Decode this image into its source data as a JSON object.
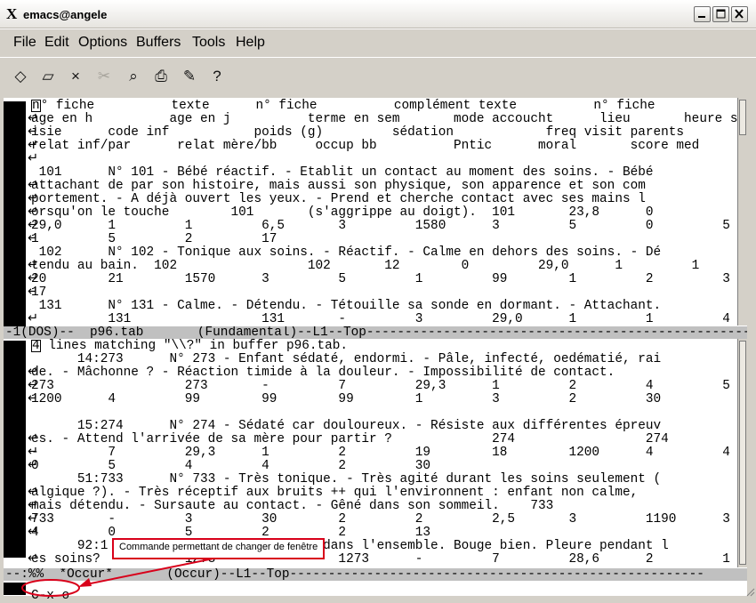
{
  "window": {
    "logo": "X",
    "title": "emacs@angele",
    "buttons": [
      "minimize",
      "maximize",
      "close"
    ]
  },
  "menu": [
    "File",
    "Edit",
    "Options",
    "Buffers",
    "Tools",
    "Help"
  ],
  "toolbar": {
    "icons": [
      "new-file-icon",
      "open-folder-icon",
      "close-x-icon",
      "cut-icon",
      "find-icon",
      "print-icon",
      "preferences-icon",
      "help-icon"
    ],
    "glyphs": [
      "◇",
      "▱",
      "×",
      "✂",
      "⌕",
      "⎙",
      "✎",
      "?"
    ]
  },
  "upper_pane": {
    "lines": [
      {
        "t": "n° fiche          texte      n° fiche          complément texte          n° fiche",
        "cursor_first": true
      },
      {
        "t": "age en h          age en j          terme en sem       mode accoucht      lieu       heure sa",
        "fringe": "↵"
      },
      {
        "t": "isie      code inf           poids (g)         sédation            freq visit parents",
        "fringe": "↵"
      },
      {
        "t": "relat inf/par      relat mère/bb     occup bb          Pntic      moral       score med",
        "fringe": "↵"
      },
      {
        "t": "",
        "fringe": "↵"
      },
      {
        "t": " 101      N° 101 - Bébé réactif. - Etablit un contact au moment des soins. - Bébé"
      },
      {
        "t": "attachant de par son histoire, mais aussi son physique, son apparence et son com",
        "fringe": "↵"
      },
      {
        "t": "portement. - A déjà ouvert les yeux. - Prend et cherche contact avec ses mains l",
        "fringe": "↵"
      },
      {
        "t": "orsqu'on le touche        101       (s'aggrippe au doigt).  101       23,8      0",
        "fringe": "↵"
      },
      {
        "t": "29,0      1         1         6,5       3         1580      3         5         0         5",
        "fringe": "↵"
      },
      {
        "t": "1         5         2         17",
        "fringe": "↵"
      },
      {
        "t": " 102      N° 102 - Tonique aux soins. - Réactif. - Calme en dehors des soins. - Dé"
      },
      {
        "t": "tendu au bain.  102                 102       12        0         29,0      1         1",
        "fringe": "↵"
      },
      {
        "t": "20        21        1570      3         5         1         99        1         2         3",
        "fringe": "↵"
      },
      {
        "t": "17",
        "fringe": "↵"
      },
      {
        "t": " 131      N° 131 - Calme. - Détendu. - Tétouille sa sonde en dormant. - Attachant."
      },
      {
        "t": "          131                 131       -         3         29,0      1         1         4",
        "fringe": "↵"
      }
    ]
  },
  "upper_modeline": "-1(DOS)--  p96.tab       (Fundamental)--L1--Top------------------------------------------------------",
  "occur_pane": {
    "header": {
      "count": "4",
      "rest": " lines matching \"\\\\?\" in buffer p96.tab."
    },
    "lines": [
      {
        "t": "      14:273      N° 273 - Enfant sédaté, endormi. - Pâle, infecté, oedématié, rai"
      },
      {
        "t": "de. - Mâchonne ? - Réaction timide à la douleur. - Impossibilité de contact.",
        "fringe": "↵"
      },
      {
        "t": "273                 273       -         7         29,3      1         2         4         5",
        "fringe": "↵"
      },
      {
        "t": "1200      4         99        99        99        1         3         2         30",
        "fringe": "↵"
      },
      {
        "t": ""
      },
      {
        "t": "      15:274      N° 274 - Sédaté car douloureux. - Résiste aux différentes épreuv"
      },
      {
        "t": "es. - Attend l'arrivée de sa mère pour partir ?             274                 274",
        "fringe": "↵"
      },
      {
        "t": "-         7         29,3      1         2         19        18        1200      4         4",
        "fringe": "↵"
      },
      {
        "t": "0         5         4         4         2         30",
        "fringe": "↵"
      },
      {
        "t": "      51:733      N° 733 - Très tonique. - Très agité durant les soins seulement ("
      },
      {
        "t": "algique ?). - Très réceptif aux bruits ++ qui l'environnent : enfant non calme,",
        "fringe": "↵"
      },
      {
        "t": "mais détendu. - Sursaute au contact. - Gêné dans son sommeil.    733",
        "fringe": "↵"
      },
      {
        "t": "733       -         3         30        2         2         2,5       3         1190      3",
        "fringe": "↵"
      },
      {
        "t": "4         0         5         2         2         13",
        "fringe": "↵"
      },
      {
        "t": "      92:1                            dans l'ensemble. Bouge bien. Pleure pendant l"
      },
      {
        "t": "es soins?           1273                1273      -         7         28,6      2         1",
        "fringe": "↵"
      }
    ]
  },
  "lower_modeline": "--:%%  *Occur*       (Occur)--L1--Top------------------------------------------------------",
  "minibuffer": "C-x o",
  "annotation": {
    "tooltip": "Commande permettant de changer de fenêtre",
    "color": "#d8001a"
  },
  "colors": {
    "modeline": "#c0c0c0",
    "chrome": "#d4d0c8",
    "annotation": "#d8001a"
  }
}
